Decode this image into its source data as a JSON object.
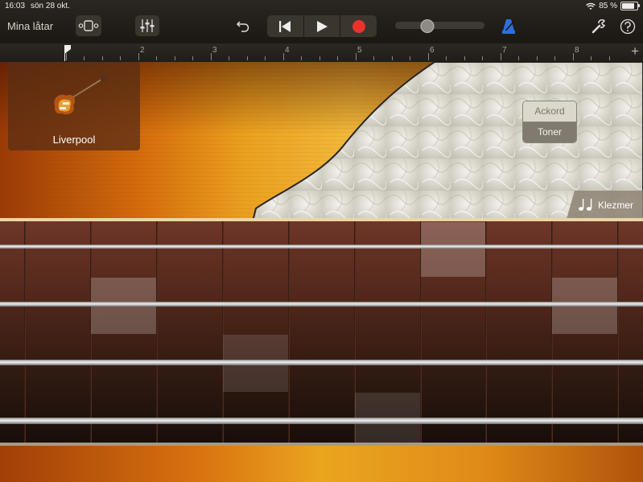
{
  "status_bar": {
    "time": "16:03",
    "date": "sön 28 okt.",
    "battery": "85 %",
    "battery_level": 0.85
  },
  "toolbar": {
    "my_songs_label": "Mina låtar",
    "icons": [
      "view-browser-icon",
      "mixer-icon",
      "undo-icon",
      "go-to-start-icon",
      "play-icon",
      "record-icon",
      "metronome-icon",
      "wrench-icon",
      "help-icon"
    ],
    "volume_level": 0.36,
    "record_color": "#e8332c",
    "metronome_color": "#2e6fe0"
  },
  "ruler": {
    "bars": [
      "2",
      "3",
      "4",
      "5",
      "6",
      "7",
      "8"
    ],
    "add_label": "+"
  },
  "instrument": {
    "name": "Liverpool",
    "icon": "bass-guitar-icon"
  },
  "mode_switch": {
    "options": [
      "Ackord",
      "Toner"
    ],
    "selected": "Toner"
  },
  "style_button": {
    "label": "Klezmer",
    "icon": "music-notes-icon"
  },
  "fretboard": {
    "strings": 4,
    "frets": 10
  }
}
